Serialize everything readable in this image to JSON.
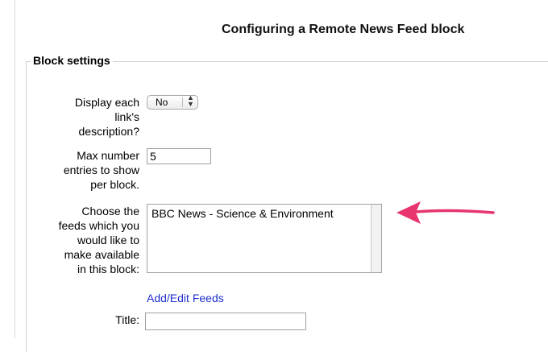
{
  "page": {
    "title": "Configuring a Remote News Feed block"
  },
  "fieldset": {
    "legend": "Block settings"
  },
  "fields": {
    "display_description": {
      "label_lines": [
        "Display each",
        "link's",
        "description?"
      ],
      "value": "No"
    },
    "max_entries": {
      "label_lines": [
        "Max number",
        "entries to show",
        "per block."
      ],
      "value": "5"
    },
    "feeds": {
      "label_lines": [
        "Choose the",
        "feeds which you",
        "would like to",
        "make available",
        "in this block:"
      ],
      "options": [
        "BBC News - Science & Environment"
      ]
    },
    "add_edit_link": "Add/Edit Feeds",
    "title": {
      "label": "Title:",
      "value": ""
    }
  },
  "annotation": {
    "arrow_color": "#e8356e"
  }
}
